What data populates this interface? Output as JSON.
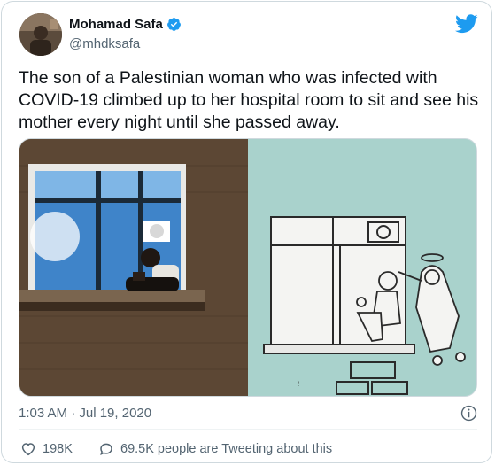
{
  "author": {
    "display_name": "Mohamad Safa",
    "handle": "@mhdksafa",
    "verified": true
  },
  "tweet": {
    "text": "The son of a Palestinian woman who was infected with COVID-19 climbed up to her hospital room to sit and see his mother every night until she passed away.",
    "timestamp": "1:03 AM · Jul 19, 2020"
  },
  "media": {
    "photo_icon": "photo-man-on-hospital-window-ledge",
    "cartoon_icon": "cartoon-man-at-window-with-angel-mother"
  },
  "stats": {
    "likes": "198K",
    "tweeting_about": "69.5K people are Tweeting about this"
  },
  "colors": {
    "accent": "#1d9bf0",
    "text": "#0f1419",
    "muted": "#536471",
    "border": "#cfd9de",
    "cartoon_background": "#a9d2cc"
  },
  "icons": {
    "logo": "twitter-bird-icon",
    "verified": "verified-badge-icon",
    "info": "info-icon",
    "like": "heart-icon",
    "reply": "speech-bubble-icon"
  }
}
